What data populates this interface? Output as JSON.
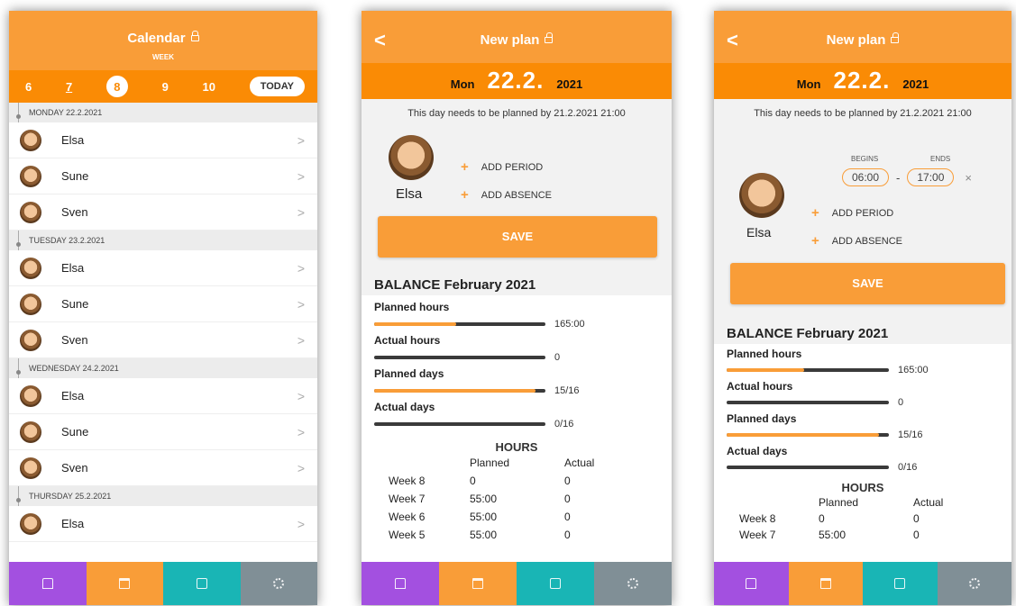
{
  "calendar": {
    "title": "Calendar",
    "subtitle": "WEEK",
    "weeks": [
      {
        "label": "6",
        "state": "normal"
      },
      {
        "label": "7",
        "state": "underlined"
      },
      {
        "label": "8",
        "state": "selected"
      },
      {
        "label": "9",
        "state": "normal"
      },
      {
        "label": "10",
        "state": "normal"
      }
    ],
    "today_label": "TODAY",
    "days": [
      {
        "label": "MONDAY 22.2.2021",
        "people": [
          "Elsa",
          "Sune",
          "Sven"
        ]
      },
      {
        "label": "TUESDAY 23.2.2021",
        "people": [
          "Elsa",
          "Sune",
          "Sven"
        ]
      },
      {
        "label": "WEDNESDAY 24.2.2021",
        "people": [
          "Elsa",
          "Sune",
          "Sven"
        ]
      },
      {
        "label": "THURSDAY 25.2.2021",
        "people": [
          "Elsa"
        ]
      }
    ],
    "chevron": ">"
  },
  "plan": {
    "title": "New plan",
    "back": "<",
    "weekday": "Mon",
    "date": "22.2.",
    "year": "2021",
    "note": "This day needs to be planned by 21.2.2021 21:00",
    "person_name": "Elsa",
    "add_period": "ADD PERIOD",
    "add_absence": "ADD ABSENCE",
    "save": "SAVE",
    "balance_title": "BALANCE February 2021",
    "balance": [
      {
        "label": "Planned hours",
        "value": "165:00",
        "fraction": 0.48
      },
      {
        "label": "Actual hours",
        "value": "0",
        "fraction": 0
      },
      {
        "label": "Planned days",
        "value": "15/16",
        "fraction": 0.94
      },
      {
        "label": "Actual days",
        "value": "0/16",
        "fraction": 0
      }
    ],
    "hours_title": "HOURS",
    "hours_cols": [
      "Planned",
      "Actual"
    ],
    "hours_rows": [
      {
        "week": "Week 8",
        "planned": "0",
        "actual": "0"
      },
      {
        "week": "Week 7",
        "planned": "55:00",
        "actual": "0"
      },
      {
        "week": "Week 6",
        "planned": "55:00",
        "actual": "0"
      },
      {
        "week": "Week 5",
        "planned": "55:00",
        "actual": "0"
      }
    ],
    "begins_label": "BEGINS",
    "ends_label": "ENDS",
    "begin_time": "06:00",
    "end_time": "17:00",
    "dash": "-",
    "remove": "×"
  },
  "colors": {
    "orange": "#f99d38",
    "dark_orange": "#fa8b05",
    "purple": "#a350e0",
    "teal": "#19b5b5",
    "gray": "#808f96"
  },
  "nav_icons": [
    "home-icon",
    "calendar-icon",
    "chat-icon",
    "settings-icon"
  ]
}
